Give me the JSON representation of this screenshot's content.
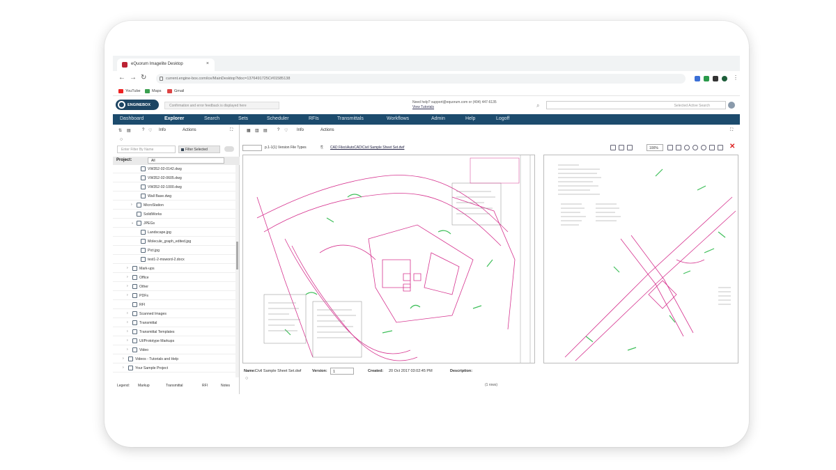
{
  "browser": {
    "tab_title": "eQuorum Imagelite Desktop",
    "tab_close": "×",
    "url": "current.engine-box.com/ice/MainDesktop?idoc=1376491725C#01585138",
    "bookmarks": [
      "YouTube",
      "Maps",
      "Gmail"
    ]
  },
  "app": {
    "logo_text": "ENGINEBOX",
    "feedback_placeholder": "Confirmation and error feedback is displayed here",
    "support_line1": "Need help? support@equorum.com or (404) 447-6135",
    "support_line2": "View Tutorials",
    "active_search_placeholder": "Selected Active Search"
  },
  "nav": [
    "Dashboard",
    "Explorer",
    "Search",
    "Sets",
    "Scheduler",
    "RFIs",
    "Transmittals",
    "Workflows",
    "Admin",
    "Help",
    "Logoff"
  ],
  "nav_active": "Explorer",
  "left": {
    "info_label": "Info",
    "actions_label": "Actions",
    "filter_placeholder": "Enter Filter By Name",
    "filter_button": "Filter Selected",
    "filter_toggle_label": "Filter",
    "project_label": "Project:",
    "project_value": "All",
    "tree": [
      {
        "label": "VW352-02-0142.dwg",
        "indent": 3,
        "arrow": ""
      },
      {
        "label": "VW352-02-0605.dwg",
        "indent": 3,
        "arrow": ""
      },
      {
        "label": "VW352-02-1000.dwg",
        "indent": 3,
        "arrow": ""
      },
      {
        "label": "Wall Base.dwg",
        "indent": 3,
        "arrow": ""
      },
      {
        "label": "MicroStation",
        "indent": 2,
        "arrow": "›"
      },
      {
        "label": "SolidWorks",
        "indent": 2,
        "arrow": ""
      },
      {
        "label": "JPEGs",
        "indent": 2,
        "arrow": "⌄"
      },
      {
        "label": "Landscape.jpg",
        "indent": 3,
        "arrow": ""
      },
      {
        "label": "Molecule_graph_edited.jpg",
        "indent": 3,
        "arrow": ""
      },
      {
        "label": "Pict.jpg",
        "indent": 3,
        "arrow": ""
      },
      {
        "label": "test1-2-msword-2.docx",
        "indent": 3,
        "arrow": ""
      },
      {
        "label": "Mark-ups",
        "indent": 1,
        "arrow": "›"
      },
      {
        "label": "Office",
        "indent": 1,
        "arrow": "›"
      },
      {
        "label": "Other",
        "indent": 1,
        "arrow": "›"
      },
      {
        "label": "PDFs",
        "indent": 1,
        "arrow": "›"
      },
      {
        "label": "RFI",
        "indent": 1,
        "arrow": ""
      },
      {
        "label": "Scanned Images",
        "indent": 1,
        "arrow": "›"
      },
      {
        "label": "Transmittal",
        "indent": 1,
        "arrow": "›"
      },
      {
        "label": "Transmittal Templates",
        "indent": 1,
        "arrow": "›"
      },
      {
        "label": "UI/Prototype Markups",
        "indent": 1,
        "arrow": "›"
      },
      {
        "label": "Video",
        "indent": 1,
        "arrow": "›"
      },
      {
        "label": "Videos - Tutorials and Help",
        "indent": 0,
        "arrow": "›"
      },
      {
        "label": "Your Sample Project",
        "indent": 0,
        "arrow": "›"
      }
    ],
    "legend": [
      "Legend:",
      "Markup",
      "Transmittal",
      "RFI",
      "Notes"
    ]
  },
  "right": {
    "info_label": "Info",
    "actions_label": "Actions",
    "path_text": "p.1-1(1) Version File Types",
    "file_link": "CAD Files\\AutoCAD\\Civil Sample Sheet Set.dwf",
    "zoom_value": "100%",
    "close_icon": "✕"
  },
  "infobar": {
    "name_label": "Name:",
    "name_value": "Civil Sample Sheet Set.dwf",
    "version_label": "Version:",
    "version_value": "1",
    "created_label": "Created:",
    "created_value": "20 Oct 2017 03:02:45 PM",
    "description_label": "Description:",
    "count_text": "(1 rows)"
  },
  "colors": {
    "nav_bg": "#1c4b6d",
    "logo_bg": "#1d4563",
    "drawing_magenta": "#d6338f",
    "drawing_green": "#3fbf5a",
    "close_red": "#dd2222"
  }
}
